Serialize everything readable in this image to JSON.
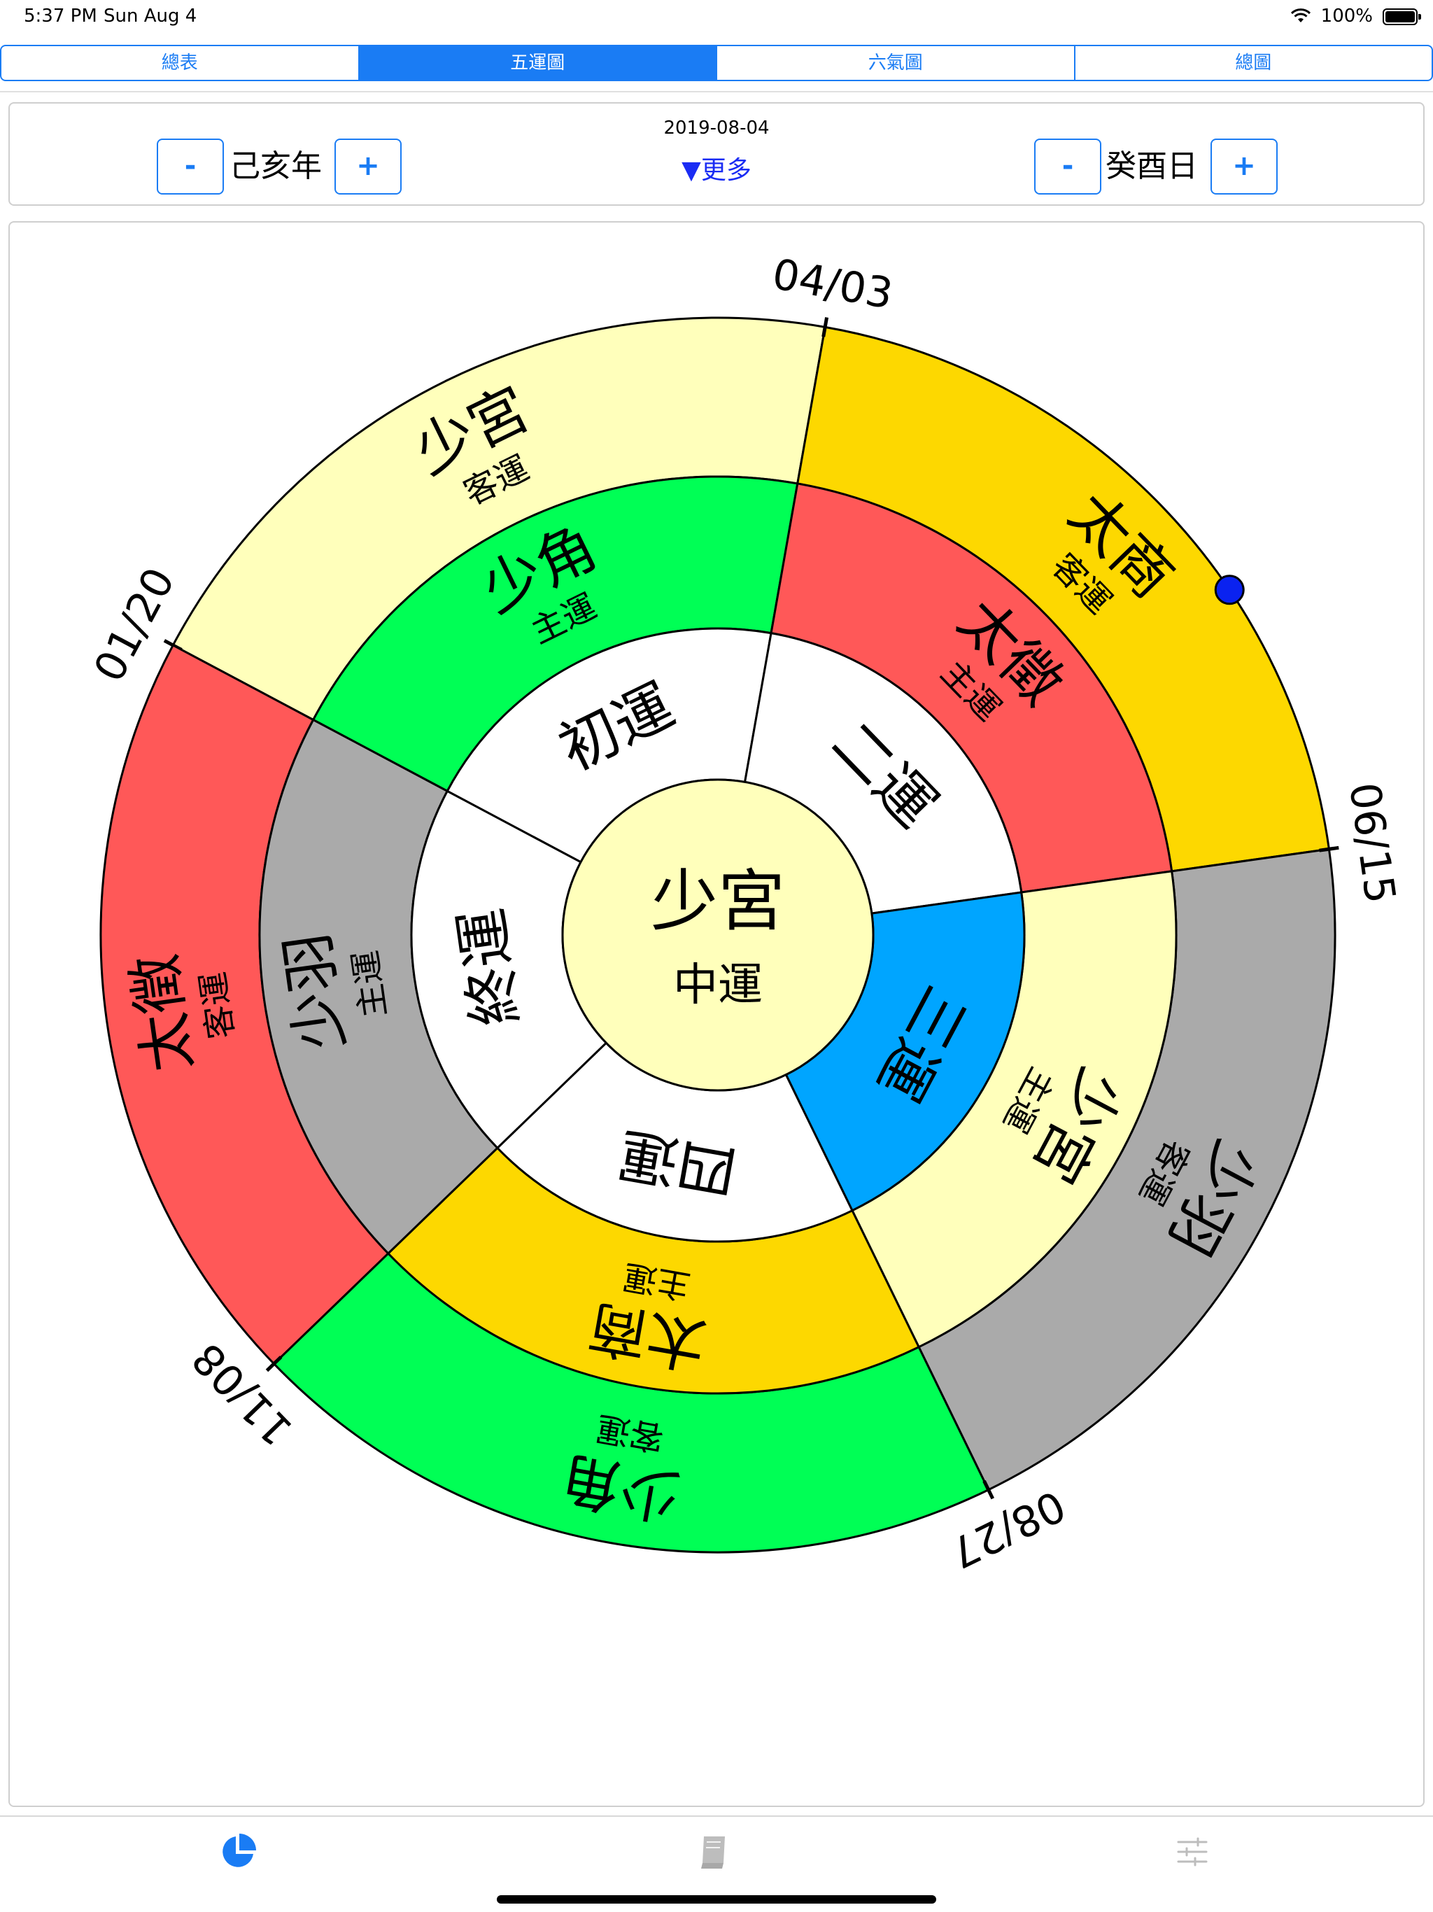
{
  "status": {
    "time": "5:37 PM",
    "date": "Sun Aug 4",
    "battery": "100%"
  },
  "tabs": [
    {
      "label": "總表",
      "active": false
    },
    {
      "label": "五運圖",
      "active": true
    },
    {
      "label": "六氣圖",
      "active": false
    },
    {
      "label": "總圖",
      "active": false
    }
  ],
  "controls": {
    "date": "2019-08-04",
    "more": "▼更多",
    "year_label": "己亥年",
    "day_label": "癸酉日",
    "minus": "-",
    "plus": "+"
  },
  "wheel": {
    "center": {
      "title": "少宮",
      "subtitle": "中運"
    },
    "stages": [
      "初運",
      "二運",
      "三運",
      "四運",
      "終運"
    ],
    "current_stage": "三運",
    "host": {
      "label": "主運",
      "names": [
        "少角",
        "太徵",
        "少宮",
        "太商",
        "少羽"
      ]
    },
    "guest": {
      "label": "客運",
      "names": [
        "少宮",
        "太商",
        "少羽",
        "少角",
        "太徵"
      ]
    },
    "dates": [
      "01/20",
      "04/03",
      "06/15",
      "08/27",
      "11/08"
    ],
    "colors": {
      "yellow": "#fdd800",
      "red": "#ff5858",
      "gray": "#aaaaaa",
      "paleyellow": "#ffffbb",
      "green": "#00ff55",
      "blue": "#00a5ff",
      "white": "#ffffff"
    },
    "host_colors": [
      "green",
      "red",
      "paleyellow",
      "yellow",
      "gray"
    ],
    "guest_colors": [
      "paleyellow",
      "yellow",
      "gray",
      "green",
      "red"
    ],
    "current_marker_color": "#0a22f0"
  },
  "tabbar": [
    {
      "icon": "pie-chart-icon",
      "active": true
    },
    {
      "icon": "book-icon",
      "active": false
    },
    {
      "icon": "sliders-icon",
      "active": false
    }
  ]
}
